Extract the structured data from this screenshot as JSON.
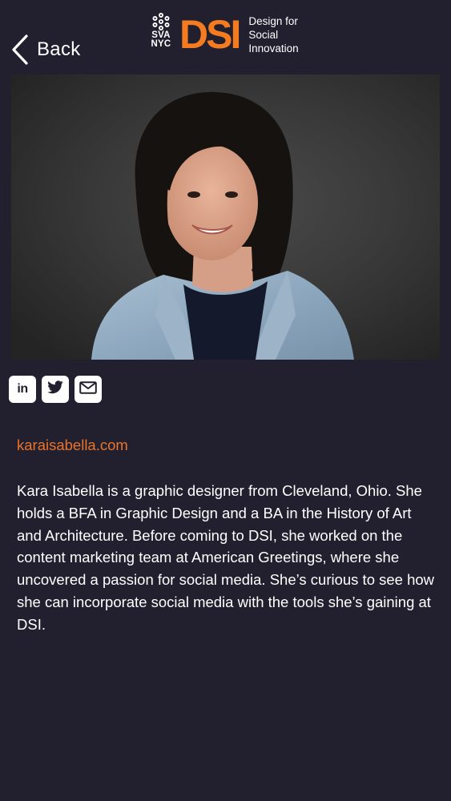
{
  "header": {
    "back_label": "Back",
    "sva_lines": [
      "SVA",
      "NYC"
    ],
    "dsi_mark": "DSI",
    "tagline_lines": [
      "Design for",
      "Social",
      "Innovation"
    ]
  },
  "profile": {
    "photo_icon": "portrait-photo",
    "social_links": [
      {
        "name": "linkedin",
        "label": "in",
        "icon": "linkedin-icon"
      },
      {
        "name": "twitter",
        "icon": "twitter-icon"
      },
      {
        "name": "email",
        "icon": "mail-icon"
      }
    ],
    "website": "karaisabella.com",
    "bio": "Kara Isabella is a graphic designer from Cleveland, Ohio. She holds a BFA in Graphic Design and a BA in the History of Art and Architecture. Before coming to DSI, she worked on the content marketing team at American Greetings, where she uncovered a passion for social media. She’s curious to see how she can incorporate social media with the tools she’s gaining at DSI."
  },
  "colors": {
    "background": "#22202f",
    "accent": "#f47b20",
    "link": "#e8732a",
    "text": "#ffffff"
  }
}
